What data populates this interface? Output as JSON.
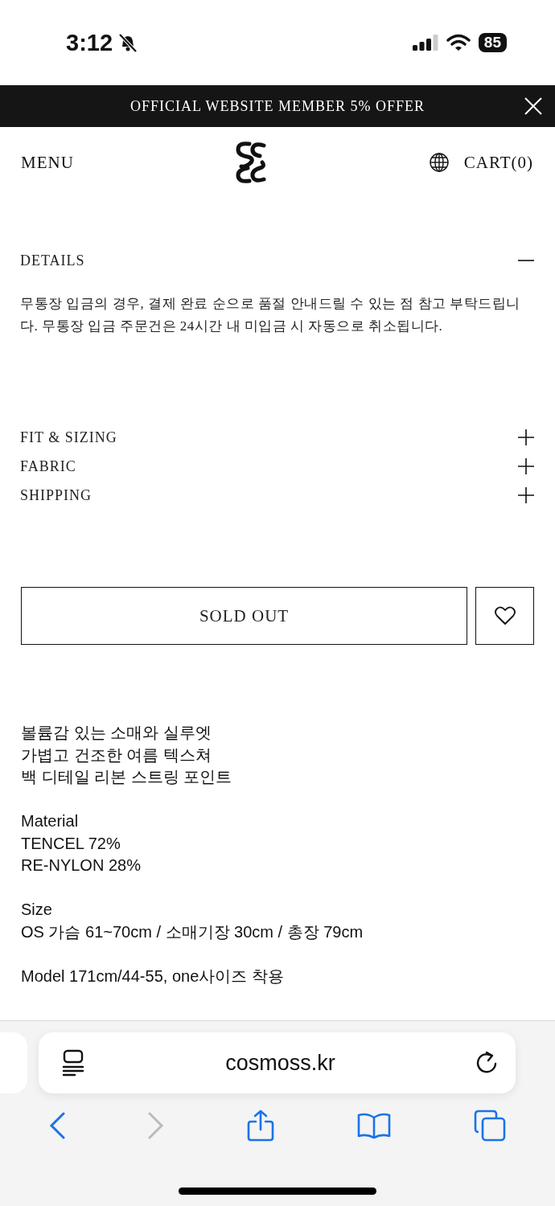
{
  "status_bar": {
    "time": "3:12",
    "battery": "85"
  },
  "banner": {
    "text": "OFFICIAL WEBSITE MEMBER 5% OFFER"
  },
  "header": {
    "menu": "MENU",
    "cart": "CART(0)"
  },
  "sections": [
    {
      "title": "DETAILS",
      "expanded": true,
      "text": "무통장 입금의 경우, 결제 완료 순으로 품절 안내드릴 수 있는 점 참고 부탁드립니다. 무통장 입금 주문건은 24시간 내 미입금 시 자동으로 취소됩니다."
    },
    {
      "title": "FIT & SIZING",
      "expanded": false
    },
    {
      "title": "FABRIC",
      "expanded": false
    },
    {
      "title": "SHIPPING",
      "expanded": false
    }
  ],
  "buy_button": {
    "label": "SOLD OUT"
  },
  "wishlist": {
    "selected": false
  },
  "description": [
    [
      "볼륨감 있는 소매와 실루엣",
      "가볍고 건조한 여름 텍스쳐",
      "백 디테일 리본 스트링 포인트"
    ],
    [
      "Material",
      "TENCEL 72%",
      "RE-NYLON 28%"
    ],
    [
      "Size",
      "OS 가슴 61~70cm / 소매기장 30cm / 총장 79cm"
    ],
    [
      "Model 171cm/44-55, one사이즈 착용"
    ]
  ],
  "browser": {
    "url": "cosmoss.kr",
    "back_enabled": true,
    "forward_enabled": false
  }
}
